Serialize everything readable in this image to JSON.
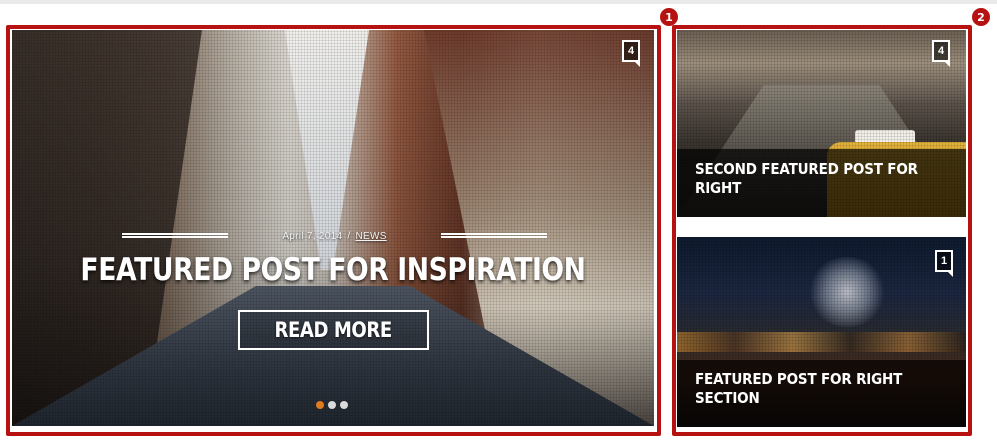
{
  "annotations": {
    "left_marker": "1",
    "right_marker": "2"
  },
  "main_slide": {
    "comment_count": "4",
    "date": "April 7, 2014",
    "separator": "/",
    "category": "NEWS",
    "title": "FEATURED POST FOR INSPIRATION",
    "read_more_label": "READ MORE",
    "pager": {
      "total": 3,
      "active_index": 0,
      "active_color": "#e07a1f",
      "inactive_color": "#dadada"
    }
  },
  "side_posts": [
    {
      "title": "SECOND FEATURED POST FOR RIGHT",
      "comment_count": "4"
    },
    {
      "title": "FEATURED POST FOR RIGHT SECTION",
      "comment_count": "1"
    }
  ],
  "colors": {
    "highlight_border": "#b71212",
    "caption_background": "rgba(0,0,0,0.7)",
    "text": "#ffffff"
  }
}
